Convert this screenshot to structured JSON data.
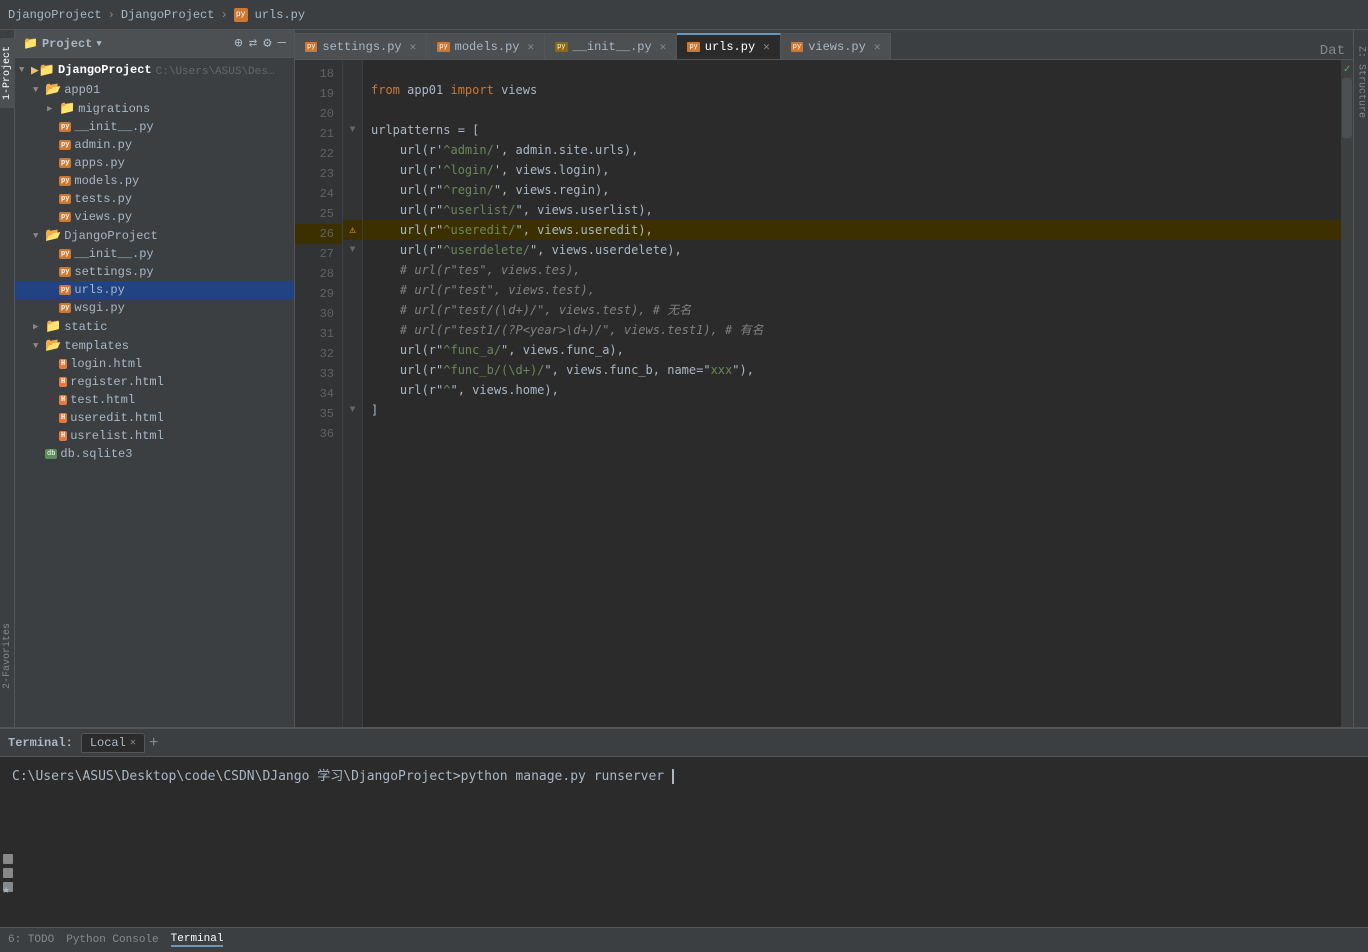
{
  "breadcrumb": {
    "root": "DjangoProject",
    "sep1": "›",
    "sub": "DjangoProject",
    "sep2": "›",
    "file": "urls.py"
  },
  "project_panel": {
    "title": "Project",
    "dropdown_icon": "▼",
    "actions": [
      "⊕",
      "⇄",
      "⚙",
      "—"
    ]
  },
  "file_tree": [
    {
      "id": "djangoproject-root",
      "indent": 0,
      "arrow": "▼",
      "type": "folder-root",
      "label": "DjangoProject",
      "extra": "C:\\Users\\ASUS\\Desktop\\code\\CSDN\\DJango 学习\\D"
    },
    {
      "id": "app01",
      "indent": 1,
      "arrow": "▼",
      "type": "folder",
      "label": "app01"
    },
    {
      "id": "migrations",
      "indent": 2,
      "arrow": "▶",
      "type": "folder",
      "label": "migrations"
    },
    {
      "id": "init-py",
      "indent": 2,
      "arrow": "",
      "type": "py",
      "label": "__init__.py"
    },
    {
      "id": "admin-py",
      "indent": 2,
      "arrow": "",
      "type": "py",
      "label": "admin.py"
    },
    {
      "id": "apps-py",
      "indent": 2,
      "arrow": "",
      "type": "py",
      "label": "apps.py"
    },
    {
      "id": "models-py",
      "indent": 2,
      "arrow": "",
      "type": "py",
      "label": "models.py"
    },
    {
      "id": "tests-py",
      "indent": 2,
      "arrow": "",
      "type": "py",
      "label": "tests.py"
    },
    {
      "id": "views-py",
      "indent": 2,
      "arrow": "",
      "type": "py",
      "label": "views.py"
    },
    {
      "id": "djangoproject-sub",
      "indent": 1,
      "arrow": "▼",
      "type": "folder",
      "label": "DjangoProject"
    },
    {
      "id": "init-py2",
      "indent": 2,
      "arrow": "",
      "type": "py",
      "label": "__init__.py"
    },
    {
      "id": "settings-py",
      "indent": 2,
      "arrow": "",
      "type": "py",
      "label": "settings.py"
    },
    {
      "id": "urls-py",
      "indent": 2,
      "arrow": "",
      "type": "py",
      "label": "urls.py"
    },
    {
      "id": "wsgi-py",
      "indent": 2,
      "arrow": "",
      "type": "py",
      "label": "wsgi.py"
    },
    {
      "id": "static",
      "indent": 1,
      "arrow": "▶",
      "type": "folder",
      "label": "static"
    },
    {
      "id": "templates",
      "indent": 1,
      "arrow": "▼",
      "type": "folder",
      "label": "templates"
    },
    {
      "id": "login-html",
      "indent": 2,
      "arrow": "",
      "type": "html",
      "label": "login.html"
    },
    {
      "id": "register-html",
      "indent": 2,
      "arrow": "",
      "type": "html",
      "label": "register.html"
    },
    {
      "id": "test-html",
      "indent": 2,
      "arrow": "",
      "type": "html",
      "label": "test.html"
    },
    {
      "id": "useredit-html",
      "indent": 2,
      "arrow": "",
      "type": "html",
      "label": "useredit.html"
    },
    {
      "id": "usrelist-html",
      "indent": 2,
      "arrow": "",
      "type": "html",
      "label": "usrelist.html"
    },
    {
      "id": "db-sqlite3",
      "indent": 1,
      "arrow": "",
      "type": "db",
      "label": "db.sqlite3"
    }
  ],
  "tabs": [
    {
      "id": "settings",
      "label": "settings.py",
      "type": "py",
      "active": false
    },
    {
      "id": "models",
      "label": "models.py",
      "type": "py",
      "active": false
    },
    {
      "id": "init",
      "label": "__init__.py",
      "type": "py-lock",
      "active": false
    },
    {
      "id": "urls",
      "label": "urls.py",
      "type": "py",
      "active": true
    },
    {
      "id": "views",
      "label": "views.py",
      "type": "py",
      "active": false
    }
  ],
  "code_lines": [
    {
      "num": 18,
      "text": "",
      "gutter": ""
    },
    {
      "num": 19,
      "text": "from app01 import views",
      "gutter": "",
      "tokens": [
        {
          "t": "from ",
          "c": "kw"
        },
        {
          "t": "app01 ",
          "c": "var"
        },
        {
          "t": "import ",
          "c": "kw"
        },
        {
          "t": "views",
          "c": "var"
        }
      ]
    },
    {
      "num": 20,
      "text": "",
      "gutter": ""
    },
    {
      "num": 21,
      "text": "urlpatterns = [",
      "gutter": "fold",
      "tokens": [
        {
          "t": "urlpatterns",
          "c": "var"
        },
        {
          "t": " = [",
          "c": "punc"
        }
      ]
    },
    {
      "num": 22,
      "text": "    url(r'^admin/', admin.site.urls),",
      "gutter": "",
      "tokens": [
        {
          "t": "    url(r'",
          "c": "var"
        },
        {
          "t": "^admin/",
          "c": "str"
        },
        {
          "t": "', admin.site.urls),",
          "c": "var"
        }
      ]
    },
    {
      "num": 23,
      "text": "    url(r'^login/', views.login),",
      "gutter": "",
      "tokens": [
        {
          "t": "    url(r'",
          "c": "var"
        },
        {
          "t": "^login/",
          "c": "str"
        },
        {
          "t": "', views.login),",
          "c": "var"
        }
      ]
    },
    {
      "num": 24,
      "text": "    url(r\"^regin/\", views.regin),",
      "gutter": "",
      "tokens": [
        {
          "t": "    url(r\"",
          "c": "var"
        },
        {
          "t": "^regin/",
          "c": "str"
        },
        {
          "t": "\", views.regin),",
          "c": "var"
        }
      ]
    },
    {
      "num": 25,
      "text": "    url(r\"^userlist/\", views.userlist),",
      "gutter": "",
      "tokens": [
        {
          "t": "    url(r\"",
          "c": "var"
        },
        {
          "t": "^userlist/",
          "c": "str"
        },
        {
          "t": "\", views.userlist),",
          "c": "var"
        }
      ]
    },
    {
      "num": 26,
      "text": "    url(r\"^useredit/\", views.useredit),",
      "gutter": "warn",
      "tokens": [
        {
          "t": "    url(r\"",
          "c": "var"
        },
        {
          "t": "^useredit/",
          "c": "str"
        },
        {
          "t": "\", views.useredit),",
          "c": "var"
        }
      ]
    },
    {
      "num": 27,
      "text": "    url(r\"^userdelete/\", views.userdelete),",
      "gutter": "fold",
      "tokens": [
        {
          "t": "    url(r\"",
          "c": "var"
        },
        {
          "t": "^userdelete/",
          "c": "str"
        },
        {
          "t": "\", views.userdelete),",
          "c": "var"
        }
      ]
    },
    {
      "num": 28,
      "text": "    # url(r\"tes\", views.tes),",
      "gutter": "",
      "tokens": [
        {
          "t": "    # url(r\"tes\", views.tes),",
          "c": "comment"
        }
      ]
    },
    {
      "num": 29,
      "text": "    # url(r\"test\", views.test),",
      "gutter": "",
      "tokens": [
        {
          "t": "    # url(r\"test\", views.test),",
          "c": "comment"
        }
      ]
    },
    {
      "num": 30,
      "text": "    # url(r\"test/(\\d+)/\", views.test), # 无名",
      "gutter": "",
      "tokens": [
        {
          "t": "    # url(r\"test/(\\d+)/\", views.test), # 无名",
          "c": "comment"
        }
      ]
    },
    {
      "num": 31,
      "text": "    # url(r\"test1/(?P<year>\\d+)/\", views.test1), # 有名",
      "gutter": "",
      "tokens": [
        {
          "t": "    # url(r\"test1/(?P<year>\\d+)/\", views.test1), # 有名",
          "c": "comment"
        }
      ]
    },
    {
      "num": 32,
      "text": "    url(r\"^func_a/\", views.func_a),",
      "gutter": "",
      "tokens": [
        {
          "t": "    url(r\"",
          "c": "var"
        },
        {
          "t": "^func_a/",
          "c": "str"
        },
        {
          "t": "\", views.func_a),",
          "c": "var"
        }
      ]
    },
    {
      "num": 33,
      "text": "    url(r\"^func_b/(\\d+)/\", views.func_b, name=\"xxx\"),",
      "gutter": "",
      "tokens": [
        {
          "t": "    url(r\"",
          "c": "var"
        },
        {
          "t": "^func_b/(\\d+)/",
          "c": "str"
        },
        {
          "t": "\", views.func_b, name=\"",
          "c": "var"
        },
        {
          "t": "xxx",
          "c": "str"
        },
        {
          "t": "\"),",
          "c": "var"
        }
      ]
    },
    {
      "num": 34,
      "text": "    url(r\"^\", views.home),",
      "gutter": "",
      "tokens": [
        {
          "t": "    url(r\"",
          "c": "var"
        },
        {
          "t": "^",
          "c": "str"
        },
        {
          "t": "\", views.home),",
          "c": "var"
        }
      ]
    },
    {
      "num": 35,
      "text": "]",
      "gutter": "fold",
      "tokens": [
        {
          "t": "]",
          "c": "punc"
        }
      ]
    },
    {
      "num": 36,
      "text": "",
      "gutter": ""
    }
  ],
  "terminal": {
    "label": "Terminal:",
    "tabs": [
      {
        "label": "Local",
        "active": true
      }
    ],
    "add_label": "+",
    "content": "C:\\Users\\ASUS\\Desktop\\code\\CSDN\\DJango 学习\\DjangoProject>python manage.py runserver"
  },
  "bottom_tabs": [
    {
      "label": "6: TODO",
      "active": false
    },
    {
      "label": "Python Console",
      "active": false
    },
    {
      "label": "Terminal",
      "active": true
    }
  ],
  "side_panels": {
    "left_top": "1-Project",
    "left_bottom": "2-Favorites",
    "right": "Z: Structure"
  },
  "colors": {
    "active_tab_border": "#6897bb",
    "warning": "#e6b422",
    "folder": "#e8c17a",
    "python_icon": "#cc7832",
    "html_icon": "#e8773c"
  }
}
